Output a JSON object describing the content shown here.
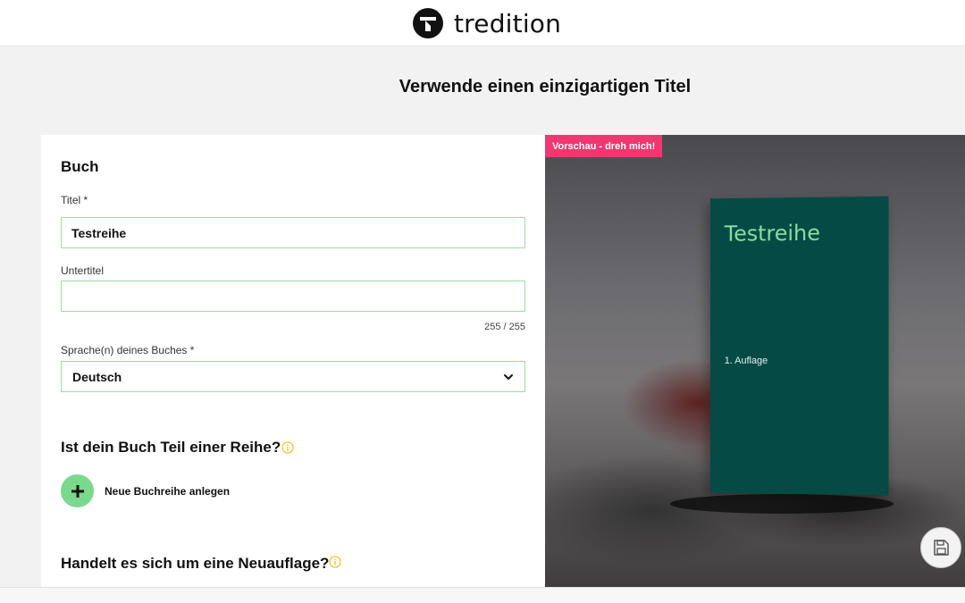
{
  "brand": {
    "name": "tredition",
    "logo_icon": "tredition-logo-icon"
  },
  "page": {
    "heading": "Verwende einen einzigartigen Titel"
  },
  "form": {
    "section_book": "Buch",
    "title_label": "Titel *",
    "title_value": "Testreihe",
    "subtitle_label": "Untertitel",
    "subtitle_value": "",
    "subtitle_counter": "255 / 255",
    "language_label": "Sprache(n) deines Buches *",
    "language_value": "Deutsch",
    "series_question": "Ist dein Buch Teil einer Reihe?",
    "new_series_label": "Neue Buchreihe anlegen",
    "new_edition_question": "Handelt es sich um eine Neuauflage?"
  },
  "preview": {
    "badge": "Vorschau - dreh mich!",
    "book_title": "Testreihe",
    "book_edition": "1. Auflage"
  },
  "colors": {
    "accent_green": "#7ad98c",
    "field_border": "#9bdba5",
    "badge_pink": "#f0376f",
    "cover_green": "#054a45",
    "cover_title": "#8fdc9e",
    "info_yellow": "#f2c230"
  },
  "icons": [
    "tredition-logo-icon",
    "chevron-down-icon",
    "info-icon",
    "plus-icon",
    "save-icon"
  ]
}
